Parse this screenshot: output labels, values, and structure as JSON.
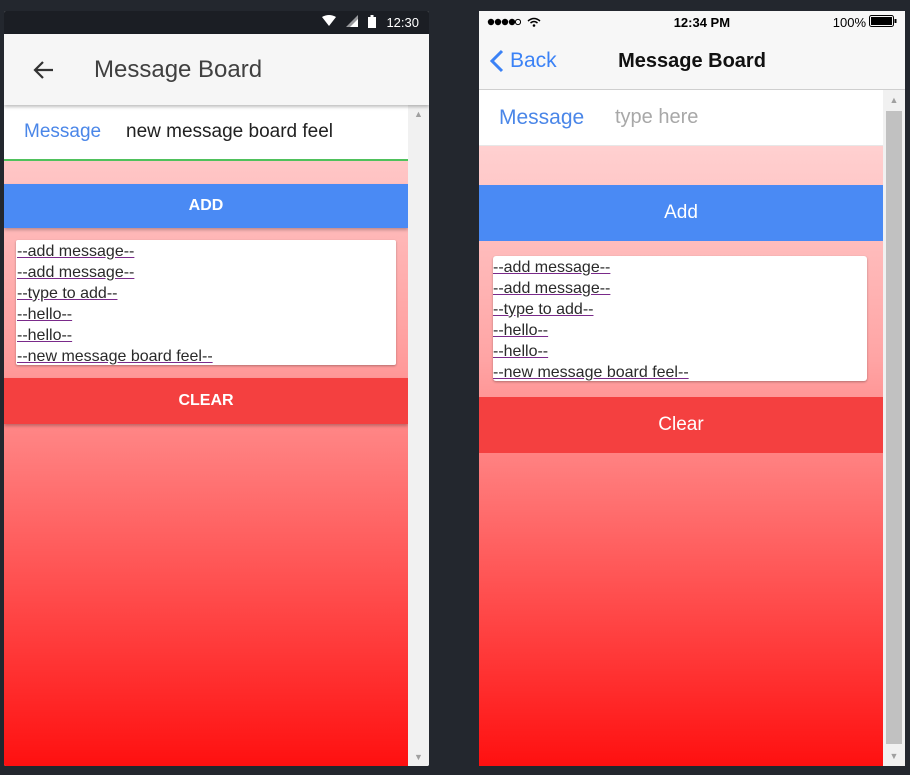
{
  "android": {
    "status_time": "12:30",
    "title": "Message Board",
    "input_label": "Message",
    "input_value": "new message board feel",
    "add_label": "ADD",
    "clear_label": "CLEAR",
    "messages": [
      "--add message--",
      "--add message--",
      "--type to add--",
      "--hello--",
      "--hello--",
      "--new message board feel--"
    ]
  },
  "ios": {
    "status_time": "12:34 PM",
    "battery": "100%",
    "back_label": "Back",
    "title": "Message Board",
    "input_label": "Message",
    "input_placeholder": "type here",
    "add_label": "Add",
    "clear_label": "Clear",
    "messages": [
      "--add message--",
      "--add message--",
      "--type to add--",
      "--hello--",
      "--hello--",
      "--new message board feel--"
    ]
  },
  "colors": {
    "accent_blue": "#4a8af4",
    "clear_red": "#f44040",
    "label_blue": "#4a86e8",
    "focus_green": "#4fc15c"
  },
  "icons": [
    "back-arrow-icon",
    "wifi-icon",
    "signal-icon",
    "battery-icon",
    "chevron-left-icon"
  ]
}
